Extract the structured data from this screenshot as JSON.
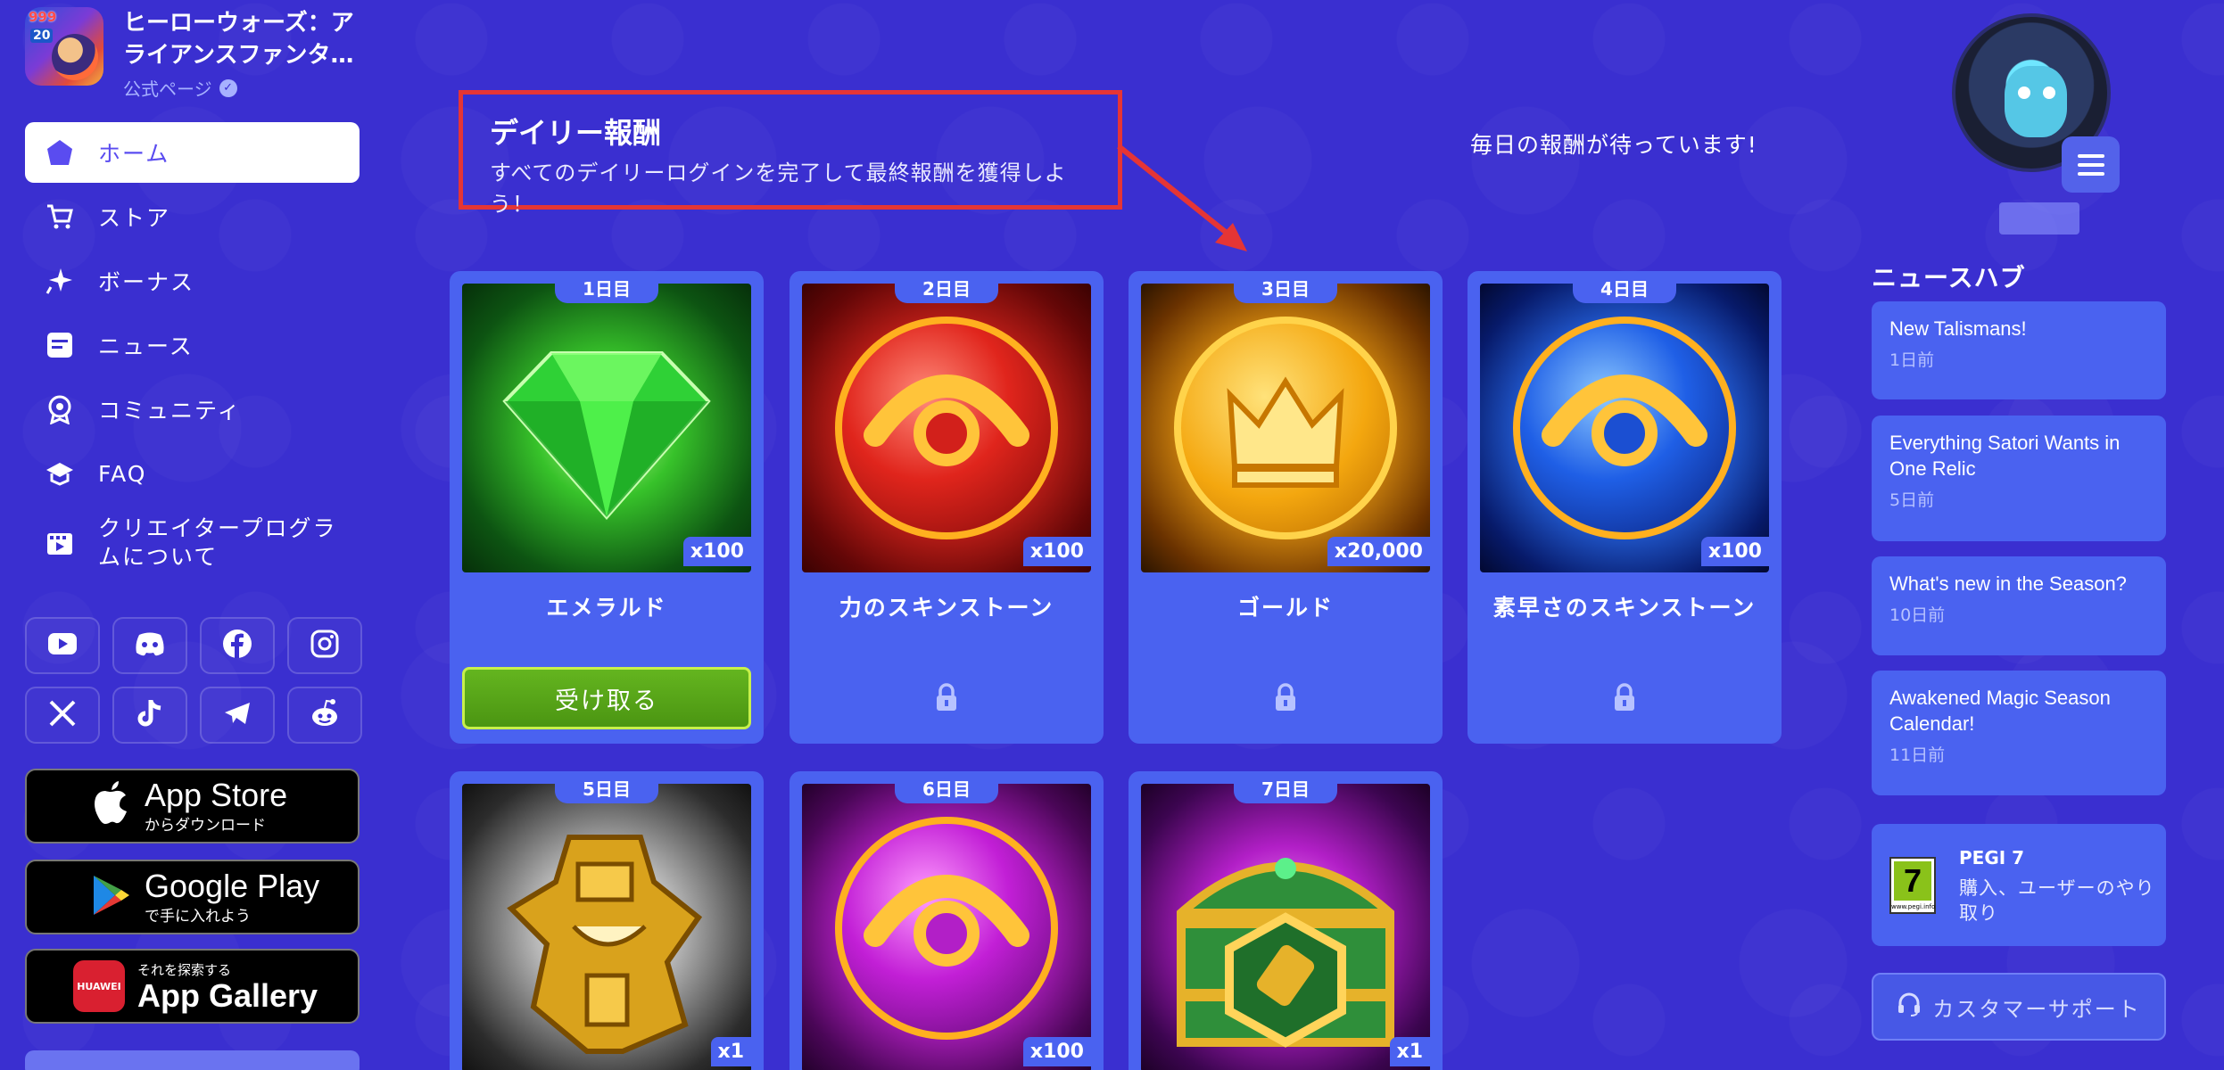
{
  "app": {
    "title": "ヒーローウォーズ：アライアンスファンタ…",
    "subtitle": "公式ページ",
    "icon_badge_top": "999",
    "icon_badge_num": "20"
  },
  "nav": {
    "items": [
      {
        "label": "ホーム",
        "icon": "home-icon",
        "active": true
      },
      {
        "label": "ストア",
        "icon": "cart-icon"
      },
      {
        "label": "ボーナス",
        "icon": "sparkle-icon"
      },
      {
        "label": "ニュース",
        "icon": "news-icon"
      },
      {
        "label": "コミュニティ",
        "icon": "community-icon"
      },
      {
        "label": "FAQ",
        "icon": "faq-icon"
      },
      {
        "label": "クリエイタープログラムについて",
        "icon": "film-icon"
      }
    ]
  },
  "social": [
    "youtube-icon",
    "discord-icon",
    "facebook-icon",
    "instagram-icon",
    "x-icon",
    "tiktok-icon",
    "telegram-icon",
    "reddit-icon"
  ],
  "stores": {
    "apple": {
      "big": "App Store",
      "small": "からダウンロード"
    },
    "google": {
      "big": "Google Play",
      "small": "で手に入れよう"
    },
    "huawei": {
      "logo": "HUAWEI",
      "small": "それを探索する",
      "big": "App Gallery"
    }
  },
  "header": {
    "title": "デイリー報酬",
    "subtitle": "すべてのデイリーログインを完了して最終報酬を獲得しよう！",
    "awaiting": "毎日の報酬が待っています!"
  },
  "rewards": [
    {
      "day": "1日目",
      "name": "エメラルド",
      "qty": "x100",
      "claimable": true
    },
    {
      "day": "2日目",
      "name": "力のスキンストーン",
      "qty": "x100",
      "claimable": false
    },
    {
      "day": "3日目",
      "name": "ゴールド",
      "qty": "x20,000",
      "claimable": false
    },
    {
      "day": "4日目",
      "name": "素早さのスキンストーン",
      "qty": "x100",
      "claimable": false
    },
    {
      "day": "5日目",
      "name": "",
      "qty": "x1",
      "claimable": false
    },
    {
      "day": "6日目",
      "name": "",
      "qty": "x100",
      "claimable": false
    },
    {
      "day": "7日目",
      "name": "",
      "qty": "x1",
      "claimable": false
    }
  ],
  "claim_label": "受け取る",
  "news": {
    "title": "ニュースハブ",
    "items": [
      {
        "title": "New Talismans!",
        "date": "1日前"
      },
      {
        "title": "Everything Satori Wants in One Relic",
        "date": "5日前"
      },
      {
        "title": "What's new in the Season?",
        "date": "10日前"
      },
      {
        "title": "Awakened Magic Season Calendar!",
        "date": "11日前"
      }
    ]
  },
  "pegi": {
    "rating": "7",
    "title": "PEGI 7",
    "desc": "購入、ユーザーのやり取り",
    "url": "www.pegi.info"
  },
  "support": {
    "label": "カスタマーサポート"
  },
  "colors": {
    "background": "#3a2fd0",
    "card": "#4a62f0",
    "claim": "#5aa81a",
    "callout_border": "#e53535"
  }
}
